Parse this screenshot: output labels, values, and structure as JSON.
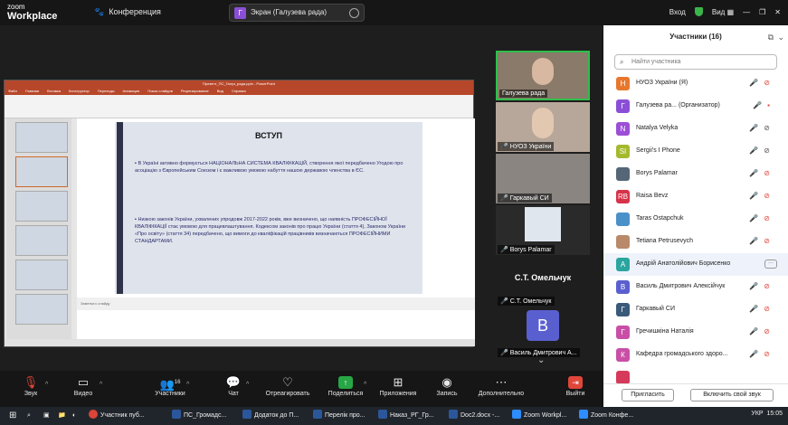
{
  "topbar": {
    "brand_line1": "zoom",
    "brand_line2": "Workplace",
    "meeting_title": "Конференция",
    "share_badge": "Г",
    "share_label": "Экран (Галузева рада)",
    "login": "Вход",
    "view": "Вид"
  },
  "presentation": {
    "window_title": "Презент_ПС_Галуз_рада.pptx - PowerPoint",
    "tabs": [
      "Файл",
      "Главная",
      "Вставка",
      "Конструктор",
      "Переходы",
      "Анимация",
      "Показ слайдов",
      "Рецензирование",
      "Вид",
      "Справка"
    ],
    "slide_heading": "ВСТУП",
    "paragraph1": "▪ В Україні активно формується НАЦІОНАЛЬНА СИСТЕМА КВАЛІФІКАЦІЙ, створення якої передбачено Угодою про асоціацію з Європейським Союзом і є важливою умовою набуття нашою державою членства в ЄС.",
    "paragraph2": "▪ Низкою законів України, ухвалених упродовж 2017-2022 років, вже визначено, що наявність ПРОФЕСІЙНОЇ КВАЛІФІКАЦІЇ стає умовою для працевлаштування. Кодексом законів про працю України (стаття 4), Законом України «Про освіту» (стаття 34) передбачено, що вимоги до кваліфікацій працівників визначаються ПРОФЕСІЙНИМИ СТАНДАРТАМИ.",
    "notes_placeholder": "Заметки к слайду"
  },
  "video_tiles": [
    {
      "name": "Галузева рада",
      "muted": false
    },
    {
      "name": "НУОЗ України",
      "muted": true
    },
    {
      "name": "Гаркавый СИ",
      "muted": true
    },
    {
      "name": "Borys Palamar",
      "muted": true
    },
    {
      "name": "С.Т. Омельчук",
      "muted": true,
      "label": "С.Т. Омельчук"
    },
    {
      "name": "Василь Дмитрович А...",
      "muted": true,
      "letter": "В"
    }
  ],
  "participants": {
    "title": "Участники (16)",
    "search_placeholder": "Найти участника",
    "list": [
      {
        "initials": "Н",
        "color": "#e8772e",
        "name": "НУОЗ України (Я)"
      },
      {
        "initials": "Г",
        "color": "#8a4fd6",
        "name": "Галузева ра... (Организатор)"
      },
      {
        "initials": "N",
        "color": "#9c4fd6",
        "name": "Natalya Velyka"
      },
      {
        "initials": "SI",
        "color": "#a6b92e",
        "name": "Sergii's I Phone"
      },
      {
        "initials": "",
        "color": "#556677",
        "name": "Borys Palamar"
      },
      {
        "initials": "RB",
        "color": "#d6334a",
        "name": "Raisa Bevz"
      },
      {
        "initials": "",
        "color": "#4a90c9",
        "name": "Taras Ostapchuk"
      },
      {
        "initials": "",
        "color": "#b98a6a",
        "name": "Tetiana Petrusevych"
      },
      {
        "initials": "А",
        "color": "#2aa5a0",
        "name": "Андрій Анатолійович Борисенко"
      },
      {
        "initials": "В",
        "color": "#5a5fd0",
        "name": "Василь Дмитрович Алексійчук"
      },
      {
        "initials": "Г",
        "color": "#3a5a7a",
        "name": "Гаркавый СИ"
      },
      {
        "initials": "Г",
        "color": "#c94fa6",
        "name": "Гречишкіна Наталія"
      },
      {
        "initials": "К",
        "color": "#c94fa6",
        "name": "Кафедра громадського здоро..."
      },
      {
        "initials": "",
        "color": "#d63a5a",
        "name": ""
      }
    ],
    "invite_button": "Пригласить",
    "unmute_button": "Включить свой звук"
  },
  "controls": {
    "audio": "Звук",
    "video": "Видео",
    "participants": "Участники",
    "participants_count": "16",
    "chat": "Чат",
    "react": "Отреагировать",
    "share": "Поделиться",
    "apps": "Приложения",
    "record": "Запись",
    "more": "Дополнительно",
    "leave": "Выйти"
  },
  "taskbar": {
    "items": [
      "Участник пуб...",
      "ПС_Громадс...",
      "Додаток до П...",
      "Перелік про...",
      "Наказ_РГ_Гр...",
      "Doc2.docx -...",
      "Zoom Workpl...",
      "Zoom Конфе..."
    ],
    "language": "УКР",
    "time": "15:05"
  }
}
